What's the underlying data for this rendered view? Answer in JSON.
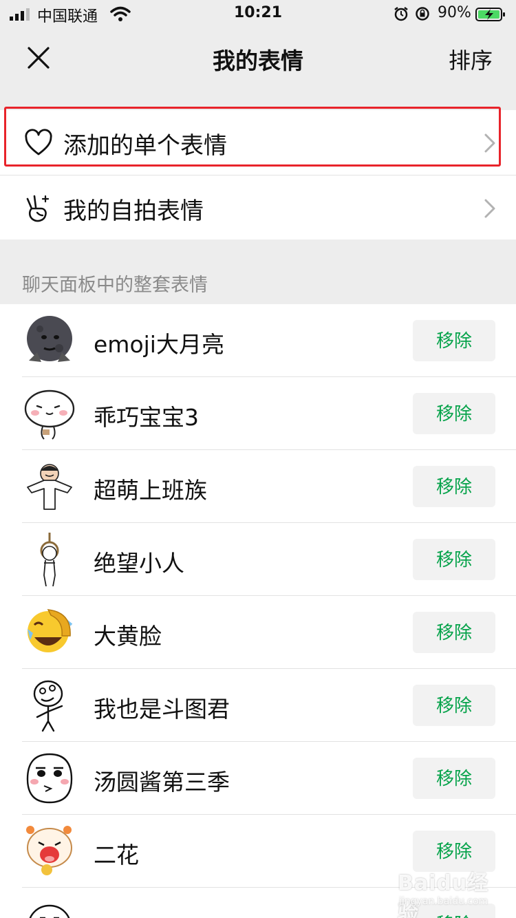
{
  "status_bar": {
    "carrier": "中国联通",
    "time": "10:21",
    "battery": "90%"
  },
  "navbar": {
    "title": "我的表情",
    "sort_label": "排序"
  },
  "menu": {
    "items": [
      {
        "label": "添加的单个表情",
        "icon": "heart-icon"
      },
      {
        "label": "我的自拍表情",
        "icon": "victory-hand-icon"
      }
    ]
  },
  "section": {
    "title": "聊天面板中的整套表情"
  },
  "packs": [
    {
      "name": "emoji大月亮",
      "action": "移除"
    },
    {
      "name": "乖巧宝宝3",
      "action": "移除"
    },
    {
      "name": "超萌上班族",
      "action": "移除"
    },
    {
      "name": "绝望小人",
      "action": "移除"
    },
    {
      "name": "大黄脸",
      "action": "移除"
    },
    {
      "name": "我也是斗图君",
      "action": "移除"
    },
    {
      "name": "汤圆酱第三季",
      "action": "移除"
    },
    {
      "name": "二花",
      "action": "移除"
    },
    {
      "name": "",
      "action": "移除"
    }
  ],
  "watermark": {
    "brand": "Baidu经验",
    "url": "jingyan.baidu.com"
  },
  "colors": {
    "accent_green": "#07a34b",
    "highlight_red": "#e8232a",
    "background": "#ededed"
  }
}
